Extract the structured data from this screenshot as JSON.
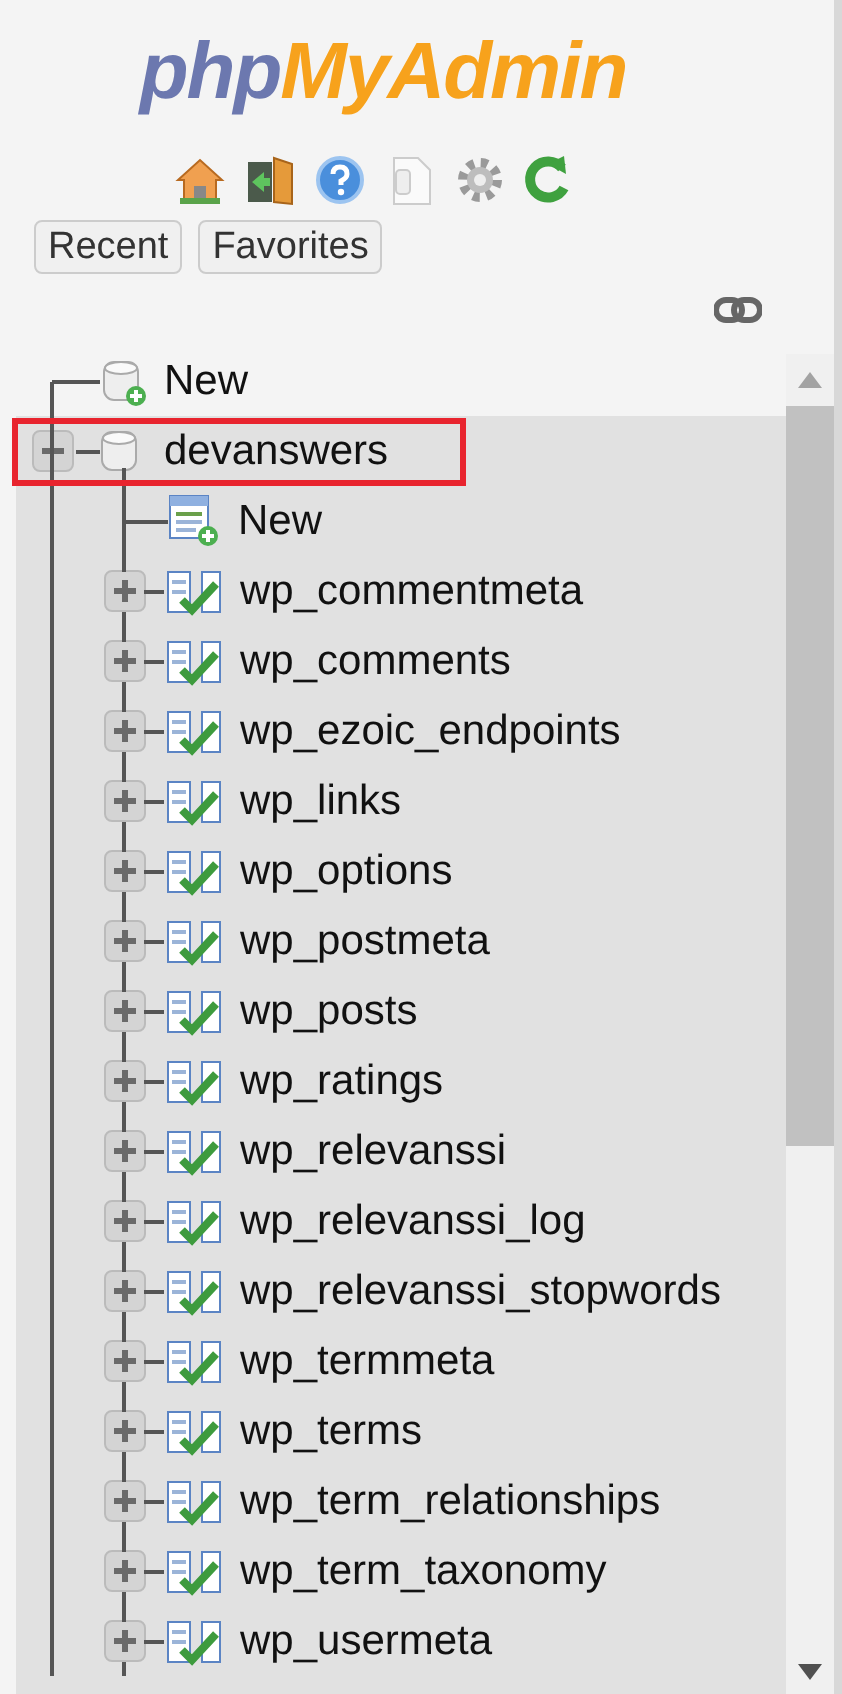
{
  "logo": {
    "first": "php",
    "second": "MyAdmin"
  },
  "nav_buttons": [
    "Recent",
    "Favorites"
  ],
  "tree": {
    "new_item": {
      "label": "New"
    },
    "database": {
      "name": "devanswers",
      "expanded": true,
      "highlighted": true,
      "children": [
        {
          "kind": "new",
          "label": "New"
        },
        {
          "kind": "table",
          "label": "wp_commentmeta",
          "expanded": false
        },
        {
          "kind": "table",
          "label": "wp_comments",
          "expanded": false
        },
        {
          "kind": "table",
          "label": "wp_ezoic_endpoints",
          "expanded": false
        },
        {
          "kind": "table",
          "label": "wp_links",
          "expanded": false
        },
        {
          "kind": "table",
          "label": "wp_options",
          "expanded": false
        },
        {
          "kind": "table",
          "label": "wp_postmeta",
          "expanded": false
        },
        {
          "kind": "table",
          "label": "wp_posts",
          "expanded": false
        },
        {
          "kind": "table",
          "label": "wp_ratings",
          "expanded": false
        },
        {
          "kind": "table",
          "label": "wp_relevanssi",
          "expanded": false
        },
        {
          "kind": "table",
          "label": "wp_relevanssi_log",
          "expanded": false
        },
        {
          "kind": "table",
          "label": "wp_relevanssi_stopwords",
          "expanded": false
        },
        {
          "kind": "table",
          "label": "wp_termmeta",
          "expanded": false
        },
        {
          "kind": "table",
          "label": "wp_terms",
          "expanded": false
        },
        {
          "kind": "table",
          "label": "wp_term_relationships",
          "expanded": false
        },
        {
          "kind": "table",
          "label": "wp_term_taxonomy",
          "expanded": false
        },
        {
          "kind": "table",
          "label": "wp_usermeta",
          "expanded": false
        }
      ]
    }
  }
}
